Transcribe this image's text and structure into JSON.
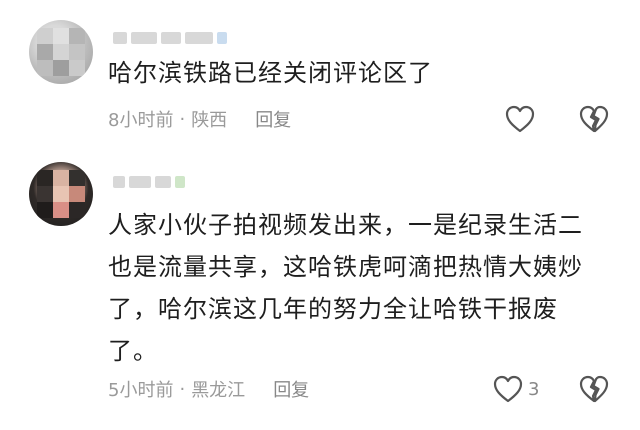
{
  "comments": [
    {
      "text": "哈尔滨铁路已经关闭评论区了",
      "time": "8小时前",
      "separator": "·",
      "location": "陕西",
      "reply_label": "回复",
      "like_count": ""
    },
    {
      "text": "人家小伙子拍视频发出来，一是纪录生活二也是流量共享，这哈铁虎呵滴把热情大姨炒了，哈尔滨这几年的努力全让哈铁干报废了。",
      "time": "5小时前",
      "separator": "·",
      "location": "黑龙江",
      "reply_label": "回复",
      "like_count": "3"
    }
  ],
  "icons": {
    "like": "heart-outline-icon",
    "dislike": "broken-heart-icon"
  },
  "colors": {
    "meta_text": "#9a9a9a",
    "icon_stroke": "#555555"
  }
}
